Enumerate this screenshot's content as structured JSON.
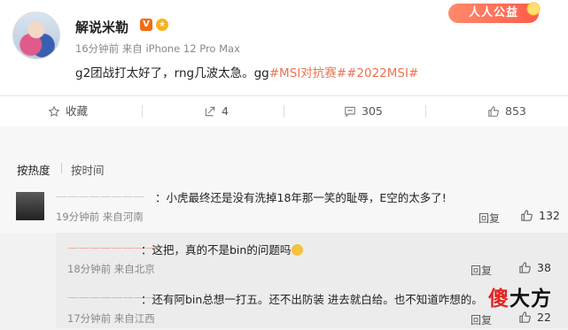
{
  "post": {
    "username": "解说米勒",
    "v_badge": "V",
    "gold_badge": "★",
    "charity_badge": "人人公益",
    "meta": "16分钟前  来自 iPhone 12 Pro Max",
    "text": "g2团战打太好了，rng几波太急。gg",
    "tag1": "#MSI对抗赛#",
    "tag2": "#2022MSI#"
  },
  "actions": {
    "favorite": "收藏",
    "repost": "4",
    "comments": "305",
    "likes": "853"
  },
  "sort": {
    "hot": "按热度",
    "time": "按时间"
  },
  "comment": {
    "name": "————————",
    "text": "：小虎最终还是没有洗掉18年那一笑的耻辱，E空的太多了!",
    "meta": "19分钟前  来自河南",
    "reply": "回复",
    "likes": "132"
  },
  "replies": [
    {
      "name": "————————",
      "text": "：这把，真的不是bin的问题吗",
      "meta": "18分钟前  来自北京",
      "reply": "回复",
      "likes": "38"
    },
    {
      "name": "————————",
      "text": "：还有阿bin总想一打五。还不出防装 进去就白给。也不知道咋想的。",
      "meta": "17分钟前  来自江西",
      "reply": "回复",
      "likes": "22"
    }
  ],
  "watermark": {
    "char1": "傻",
    "rest": "大方"
  }
}
